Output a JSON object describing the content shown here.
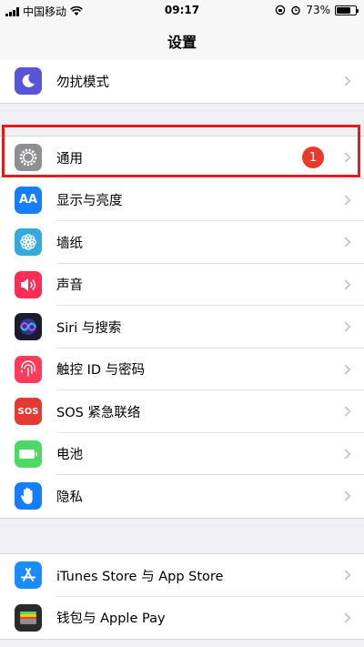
{
  "status_bar": {
    "carrier": "中国移动",
    "time": "09:17",
    "battery": "73%",
    "battery_level": 0.73
  },
  "nav": {
    "title": "设置"
  },
  "group_top": [
    {
      "label": "勿扰模式",
      "icon": "moon-icon",
      "color": "#5856d6"
    }
  ],
  "group_main": [
    {
      "label": "通用",
      "icon": "gear-icon",
      "color": "#8e8e93",
      "badge": "1"
    },
    {
      "label": "显示与亮度",
      "icon": "text-size-icon",
      "color": "#147efb",
      "icon_text": "AA"
    },
    {
      "label": "墙纸",
      "icon": "flower-icon",
      "color": "#34aadc"
    },
    {
      "label": "声音",
      "icon": "speaker-icon",
      "color": "#ff2d55"
    },
    {
      "label": "Siri 与搜索",
      "icon": "siri-icon",
      "color": "#1c1c2e"
    },
    {
      "label": "触控 ID 与密码",
      "icon": "fingerprint-icon",
      "color": "#ff3b5c"
    },
    {
      "label": "SOS 紧急联络",
      "icon": "sos-icon",
      "color": "#e53935",
      "icon_text": "SOS"
    },
    {
      "label": "电池",
      "icon": "battery-icon",
      "color": "#4cd964"
    },
    {
      "label": "隐私",
      "icon": "hand-icon",
      "color": "#147efb"
    }
  ],
  "group_store": [
    {
      "label": "iTunes Store 与 App Store",
      "icon": "app-store-icon",
      "color": "#1a8cff"
    },
    {
      "label": "钱包与 Apple Pay",
      "icon": "wallet-icon",
      "color": "#2b2b2b"
    }
  ]
}
